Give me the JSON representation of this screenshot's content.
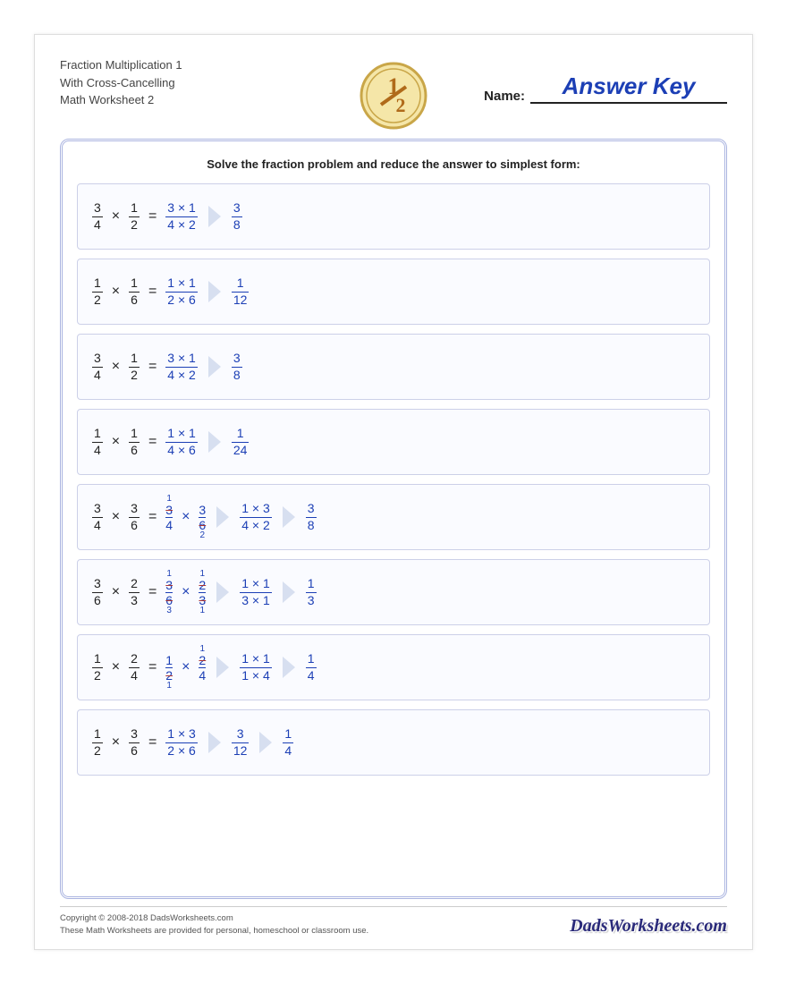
{
  "header": {
    "title_l1": "Fraction Multiplication 1",
    "title_l2": "With Cross-Cancelling",
    "title_l3": "Math Worksheet 2",
    "name_label": "Name:",
    "name_value": "Answer Key"
  },
  "instruction": "Solve the fraction problem and reduce the answer to simplest form:",
  "problems": [
    {
      "a": {
        "n": "3",
        "d": "4"
      },
      "b": {
        "n": "1",
        "d": "2"
      },
      "steps": [
        {
          "type": "frac",
          "n": "3 × 1",
          "d": "4 × 2"
        },
        {
          "type": "arrow"
        },
        {
          "type": "frac",
          "n": "3",
          "d": "8"
        }
      ]
    },
    {
      "a": {
        "n": "1",
        "d": "2"
      },
      "b": {
        "n": "1",
        "d": "6"
      },
      "steps": [
        {
          "type": "frac",
          "n": "1 × 1",
          "d": "2 × 6"
        },
        {
          "type": "arrow"
        },
        {
          "type": "frac",
          "n": "1",
          "d": "12"
        }
      ]
    },
    {
      "a": {
        "n": "3",
        "d": "4"
      },
      "b": {
        "n": "1",
        "d": "2"
      },
      "steps": [
        {
          "type": "frac",
          "n": "3 × 1",
          "d": "4 × 2"
        },
        {
          "type": "arrow"
        },
        {
          "type": "frac",
          "n": "3",
          "d": "8"
        }
      ]
    },
    {
      "a": {
        "n": "1",
        "d": "4"
      },
      "b": {
        "n": "1",
        "d": "6"
      },
      "steps": [
        {
          "type": "frac",
          "n": "1 × 1",
          "d": "4 × 6"
        },
        {
          "type": "arrow"
        },
        {
          "type": "frac",
          "n": "1",
          "d": "24"
        }
      ]
    },
    {
      "a": {
        "n": "3",
        "d": "4"
      },
      "b": {
        "n": "3",
        "d": "6"
      },
      "steps": [
        {
          "type": "cancel",
          "sup": "1",
          "n": "3",
          "d": "4",
          "sub": ""
        },
        {
          "type": "times"
        },
        {
          "type": "cancel",
          "sup": "",
          "n": "3",
          "d": "6",
          "sub": "2"
        },
        {
          "type": "arrow"
        },
        {
          "type": "frac",
          "n": "1 × 3",
          "d": "4 × 2"
        },
        {
          "type": "arrow"
        },
        {
          "type": "frac",
          "n": "3",
          "d": "8"
        }
      ]
    },
    {
      "a": {
        "n": "3",
        "d": "6"
      },
      "b": {
        "n": "2",
        "d": "3"
      },
      "steps": [
        {
          "type": "cancel",
          "sup": "1",
          "n": "3",
          "d": "6",
          "sub": "3"
        },
        {
          "type": "times"
        },
        {
          "type": "cancel",
          "sup": "1",
          "n": "2",
          "d": "3",
          "sub": "1"
        },
        {
          "type": "arrow"
        },
        {
          "type": "frac",
          "n": "1 × 1",
          "d": "3 × 1"
        },
        {
          "type": "arrow"
        },
        {
          "type": "frac",
          "n": "1",
          "d": "3"
        }
      ]
    },
    {
      "a": {
        "n": "1",
        "d": "2"
      },
      "b": {
        "n": "2",
        "d": "4"
      },
      "steps": [
        {
          "type": "cancel",
          "sup": "",
          "n": "1",
          "d": "2",
          "sub": "1"
        },
        {
          "type": "times"
        },
        {
          "type": "cancel",
          "sup": "1",
          "n": "2",
          "d": "4",
          "sub": ""
        },
        {
          "type": "arrow"
        },
        {
          "type": "frac",
          "n": "1 × 1",
          "d": "1 × 4"
        },
        {
          "type": "arrow"
        },
        {
          "type": "frac",
          "n": "1",
          "d": "4"
        }
      ]
    },
    {
      "a": {
        "n": "1",
        "d": "2"
      },
      "b": {
        "n": "3",
        "d": "6"
      },
      "steps": [
        {
          "type": "frac",
          "n": "1 × 3",
          "d": "2 × 6"
        },
        {
          "type": "arrow"
        },
        {
          "type": "frac",
          "n": "3",
          "d": "12"
        },
        {
          "type": "arrow"
        },
        {
          "type": "frac",
          "n": "1",
          "d": "4"
        }
      ]
    }
  ],
  "footer": {
    "copyright": "Copyright © 2008-2018 DadsWorksheets.com",
    "note": "These Math Worksheets are provided for personal, homeschool or classroom use.",
    "logo": "DadsWorksheets.com"
  }
}
